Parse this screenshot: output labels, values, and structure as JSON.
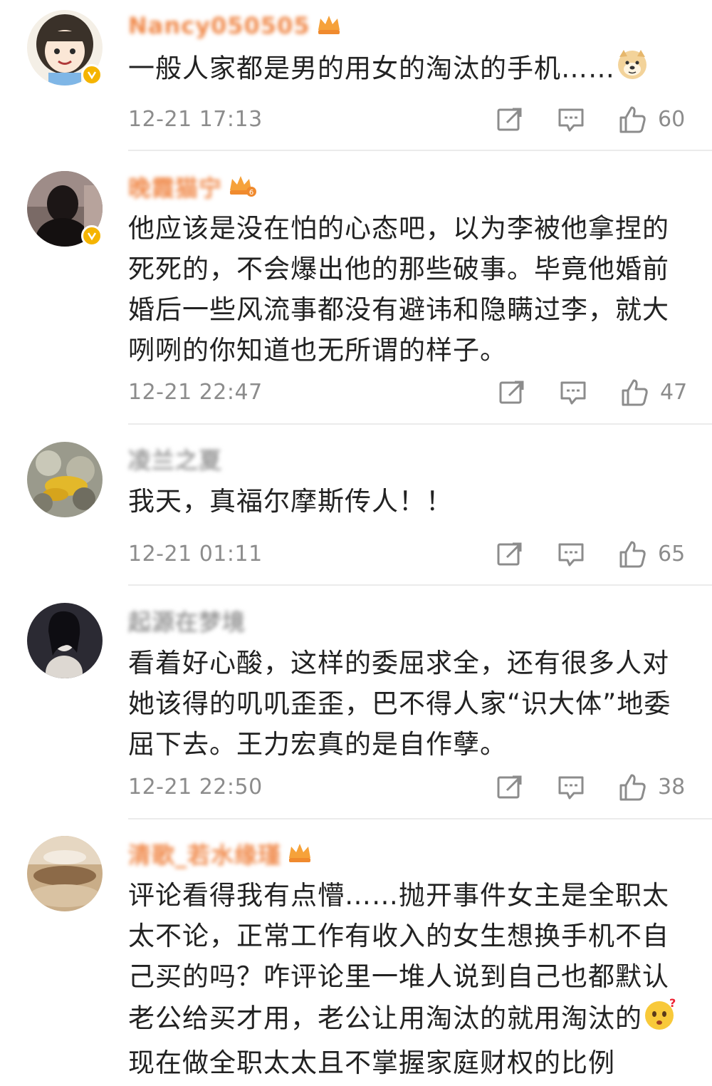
{
  "comments": [
    {
      "username": "Nancy050505",
      "text": "一般人家都是男的用女的淘汰的手机……",
      "emoji": "doge-emoji",
      "time": "12-21 17:13",
      "likes": "60"
    },
    {
      "username": "晚霞猫宁",
      "text": "他应该是没在怕的心态吧，以为李被他拿捏的死死的，不会爆出他的那些破事。毕竟他婚前婚后一些风流事都没有避讳和隐瞒过李，就大咧咧的你知道也无所谓的样子。",
      "time": "12-21 22:47",
      "likes": "47"
    },
    {
      "username": "凌兰之夏",
      "text": "我天，真福尔摩斯传人！！",
      "time": "12-21 01:11",
      "likes": "65"
    },
    {
      "username": "起源在梦境",
      "text": "看着好心酸，这样的委屈求全，还有很多人对她该得的叽叽歪歪，巴不得人家“识大体”地委屈下去。王力宏真的是自作孽。",
      "time": "12-21 22:50",
      "likes": "38"
    },
    {
      "username": "清歌_若水缘瑾",
      "text_before_emoji": "评论看得我有点懵……抛开事件女主是全职太太不论，正常工作有收入的女生想换手机不自己买的吗？咋评论里一堆人说到自己也都默认老公给买才用，老公让用淘汰的就用淘汰的",
      "emoji": "confused-emoji",
      "text_after_emoji": "现在做全职太太且不掌握家庭财权的比例"
    }
  ],
  "colors": {
    "vip_name": "#f0894a",
    "regular_name": "#9a9a9a",
    "meta_text": "#8c8c8c",
    "verified_badge": "#f5b400"
  }
}
